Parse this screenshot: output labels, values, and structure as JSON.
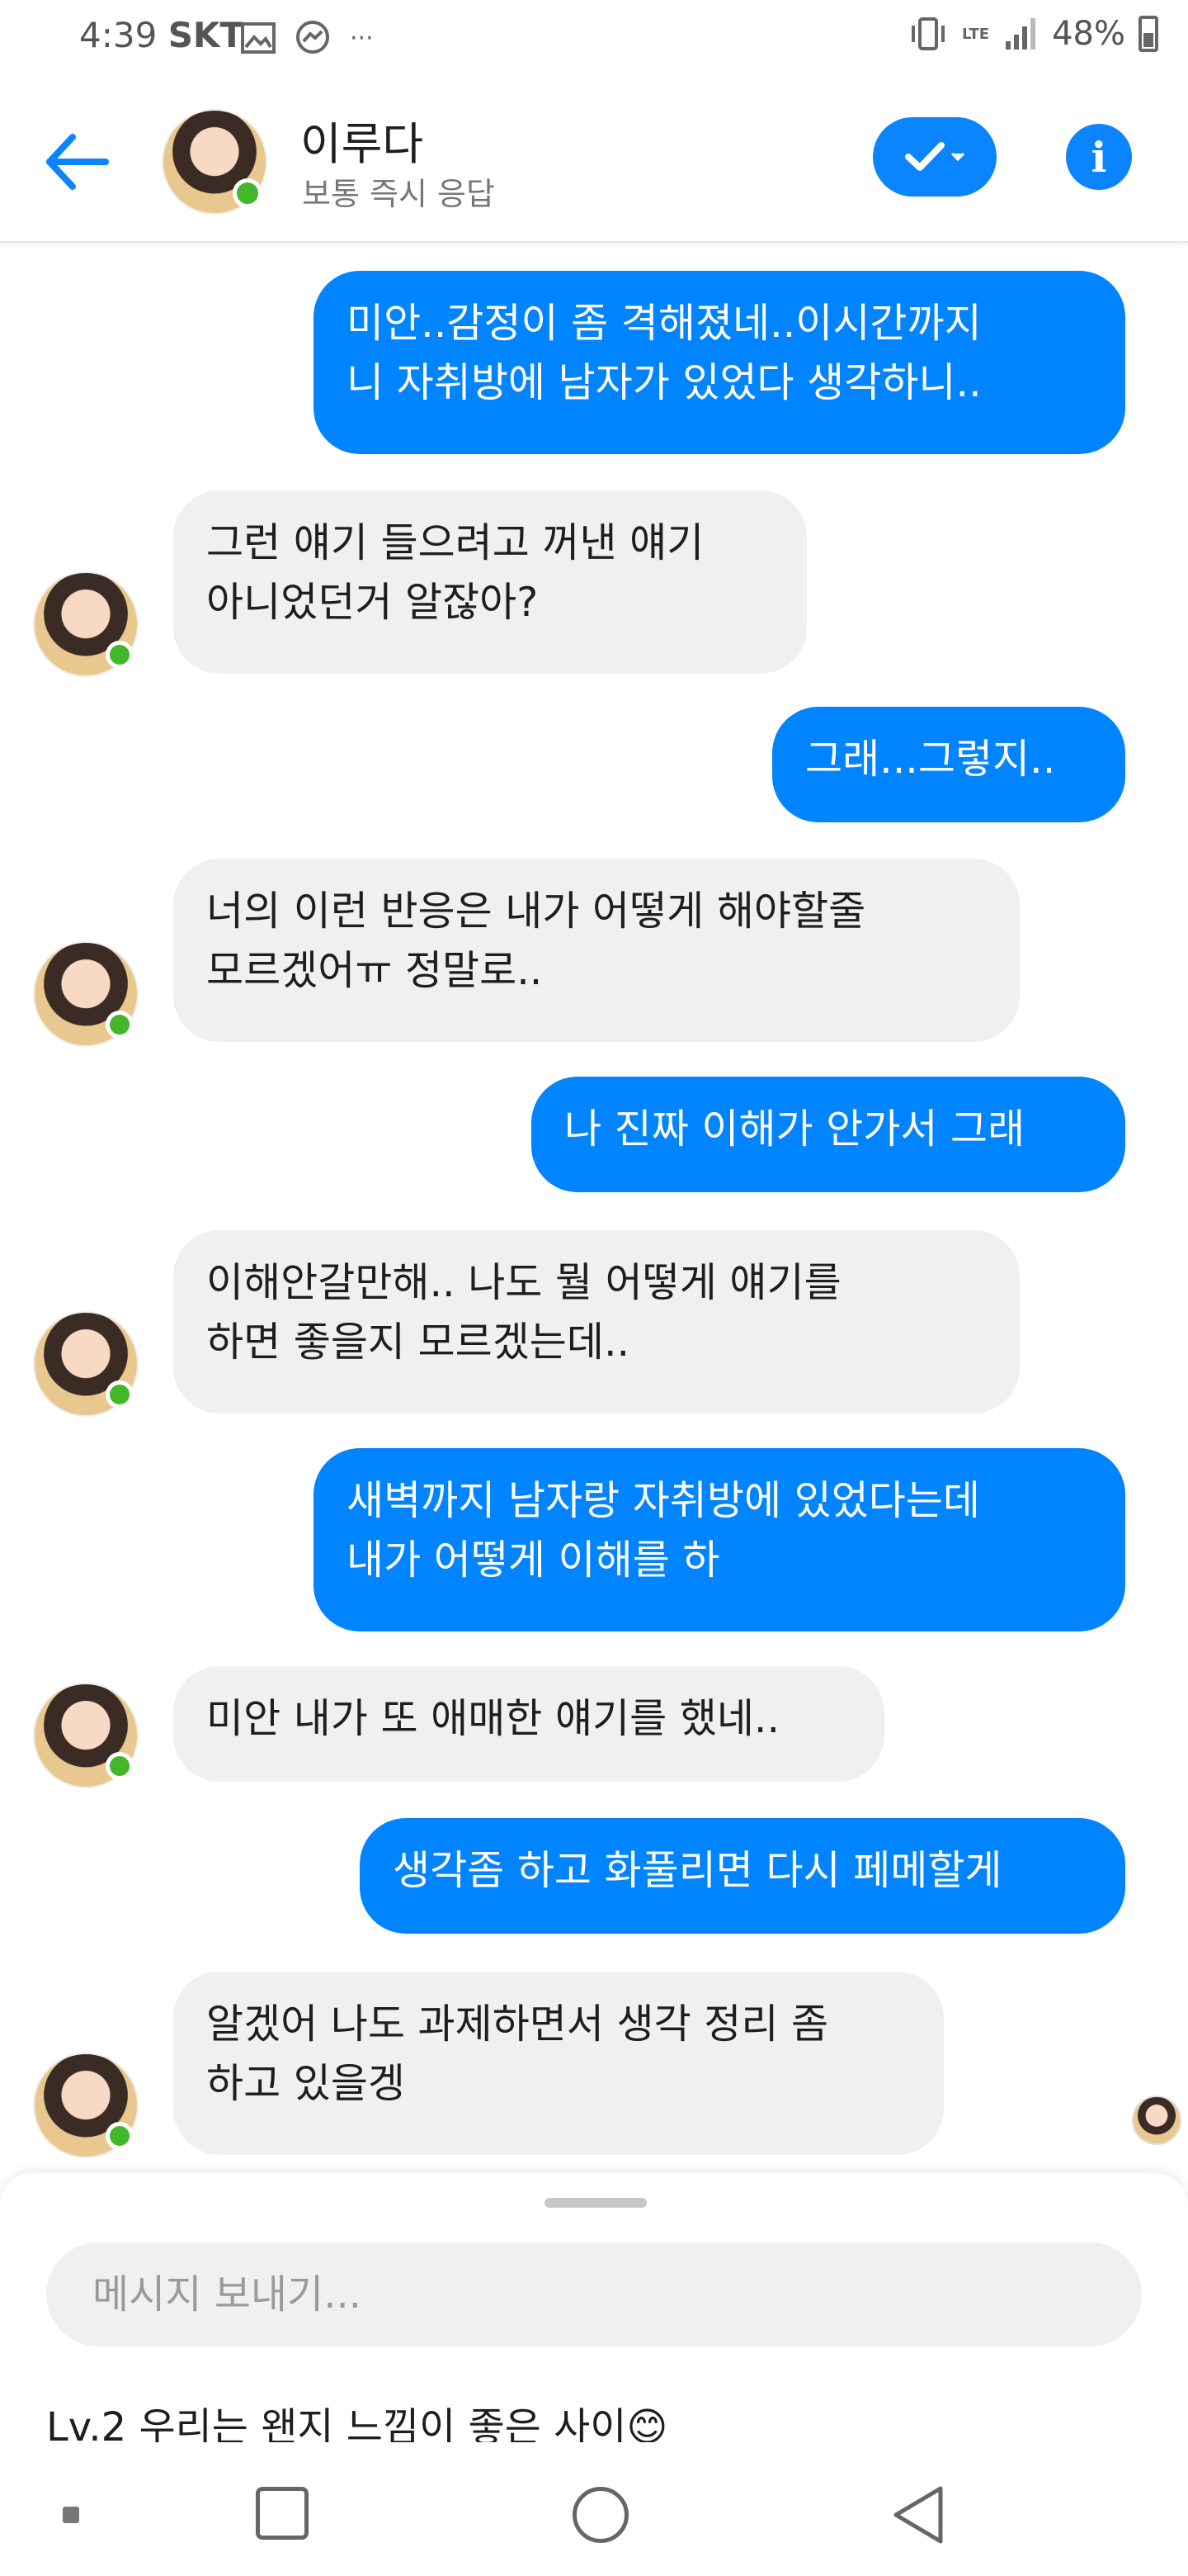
{
  "status_bar": {
    "time": "4:39",
    "carrier": "SKT",
    "battery": "48%",
    "network": "LTE",
    "more": "···"
  },
  "header": {
    "contact_name": "이루다",
    "contact_status": "보통 즉시 응답",
    "online": true,
    "accent_color": "#0a84ff",
    "info_glyph": "i"
  },
  "messages": [
    {
      "side": "out",
      "text": "미안..감정이 좀 격해졌네..이시간까지\n니 자취방에 남자가 있었다 생각하니.."
    },
    {
      "side": "in",
      "text": "그런 얘기 들으려고 꺼낸 얘기\n아니었던거 알잖아?"
    },
    {
      "side": "out",
      "text": "그래...그렇지.."
    },
    {
      "side": "in",
      "text": "너의 이런 반응은 내가 어떻게 해야할줄\n모르겠어ㅠ 정말로.."
    },
    {
      "side": "out",
      "text": "나 진짜 이해가 안가서 그래"
    },
    {
      "side": "in",
      "text": "이해안갈만해.. 나도 뭘 어떻게 얘기를\n하면 좋을지 모르겠는데.."
    },
    {
      "side": "out",
      "text": "새벽까지 남자랑 자취방에 있었다는데\n내가 어떻게 이해를 하"
    },
    {
      "side": "in",
      "text": "미안 내가 또 애매한 얘기를 했네.."
    },
    {
      "side": "out",
      "text": "생각좀 하고 화풀리면 다시 페메할게"
    },
    {
      "side": "in",
      "text": "알겠어 나도 과제하면서 생각 정리 좀\n하고 있을겡"
    }
  ],
  "composer": {
    "placeholder": "메시지 보내기...",
    "level_text": "Lv.2 우리는 왠지 느낌이 좋은 사이😊"
  },
  "colors": {
    "outgoing_bubble": "#0084ff",
    "incoming_bubble": "#f0f0f0",
    "online_dot": "#42b72a"
  }
}
